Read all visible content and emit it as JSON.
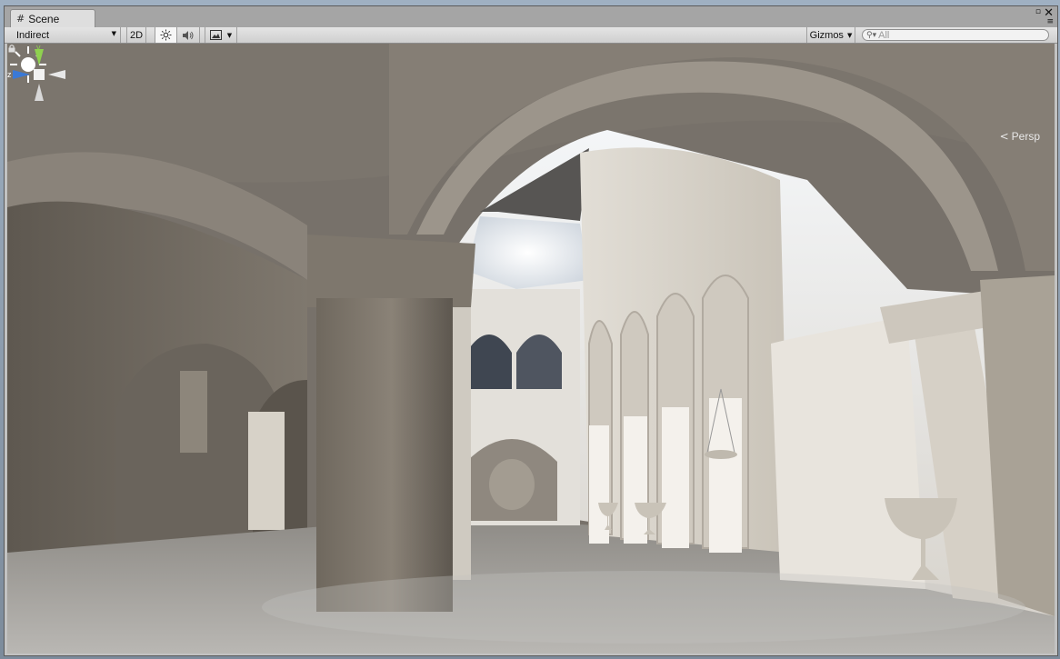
{
  "window": {
    "tab_label": "Scene",
    "tab_icon": "grid-icon"
  },
  "toolbar": {
    "render_mode": "Indirect",
    "btn_2d": "2D",
    "lighting_icon": "sun-icon",
    "audio_icon": "speaker-icon",
    "effects_icon": "image-icon",
    "gizmos_label": "Gizmos",
    "search_placeholder": "All"
  },
  "viewport": {
    "projection_label": "Persp",
    "axis_labels": {
      "y": "y",
      "z": "z"
    },
    "colors": {
      "axis_y": "#8fd14f",
      "axis_z": "#3a79d6",
      "axis_x": "#e8e8e8"
    }
  }
}
